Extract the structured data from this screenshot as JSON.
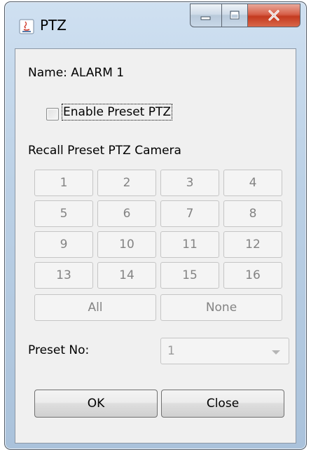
{
  "window": {
    "title": "PTZ"
  },
  "name_label": "Name: ALARM  1",
  "enable_preset": {
    "label": "Enable Preset PTZ",
    "checked": false
  },
  "recall_label": "Recall Preset PTZ Camera",
  "camera_buttons": [
    "1",
    "2",
    "3",
    "4",
    "5",
    "6",
    "7",
    "8",
    "9",
    "10",
    "11",
    "12",
    "13",
    "14",
    "15",
    "16"
  ],
  "all_label": "All",
  "none_label": "None",
  "preset_no": {
    "label": "Preset No:",
    "value": "1"
  },
  "ok_label": "OK",
  "close_label": "Close"
}
